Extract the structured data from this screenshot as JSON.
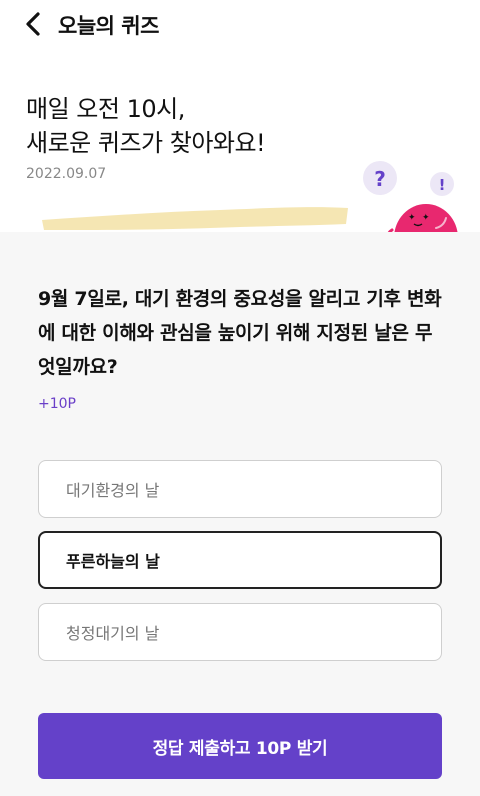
{
  "header": {
    "title": "오늘의 퀴즈"
  },
  "hero": {
    "title_line1": "매일 오전 10시,",
    "title_line2": "새로운 퀴즈가 찾아와요!",
    "date": "2022.09.07",
    "mascot_question_mark": "?",
    "mascot_exclamation": "!"
  },
  "quiz": {
    "question": "9월 7일로, 대기 환경의 중요성을 알리고 기후 변화에 대한 이해와 관심을 높이기 위해 지정된 날은 무엇일까요?",
    "points": "+10P",
    "options": [
      {
        "label": "대기환경의 날",
        "selected": false
      },
      {
        "label": "푸른하늘의 날",
        "selected": true
      },
      {
        "label": "청정대기의 날",
        "selected": false
      }
    ],
    "submit_label": "정답 제출하고 10P 받기"
  },
  "colors": {
    "accent": "#6441c9",
    "points_text": "#6a3fc8",
    "mascot_pink": "#e8286f",
    "highlight_yellow": "#f3e2a6",
    "content_bg": "#f7f7f7"
  }
}
